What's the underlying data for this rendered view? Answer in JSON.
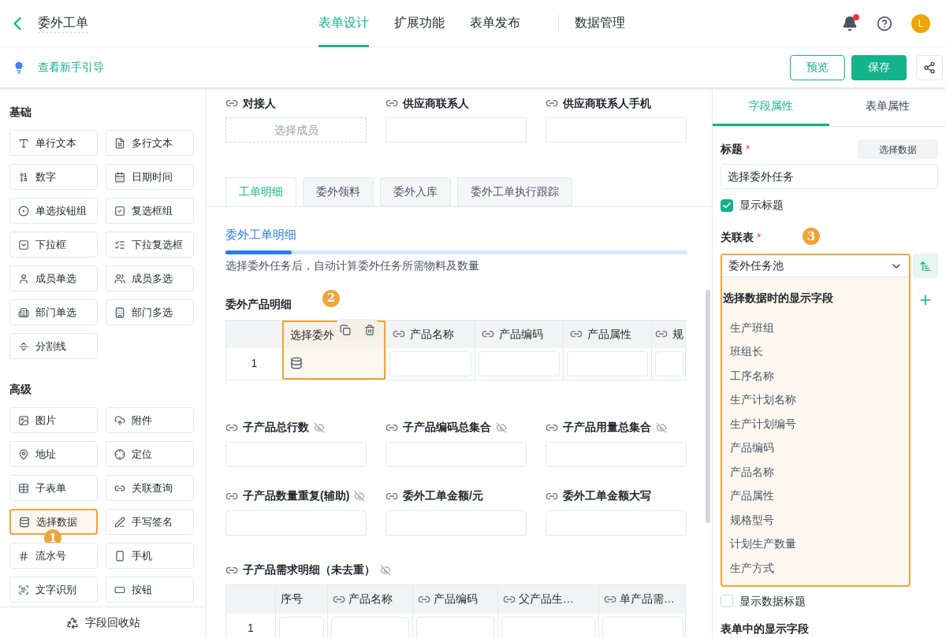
{
  "header": {
    "title": "委外工单",
    "tabs": [
      {
        "label": "表单设计",
        "selected": true
      },
      {
        "label": "扩展功能",
        "selected": false
      },
      {
        "label": "表单发布",
        "selected": false
      },
      {
        "label": "数据管理",
        "selected": false
      }
    ],
    "notification_dot": true,
    "avatar": "L"
  },
  "toolbar": {
    "guide_link": "查看新手引导",
    "preview": "预览",
    "save": "保存"
  },
  "palette": {
    "sections": [
      {
        "title": "基础",
        "items": [
          {
            "label": "单行文本",
            "highlighted": false
          },
          {
            "label": "多行文本",
            "highlighted": false
          },
          {
            "label": "数字",
            "highlighted": false
          },
          {
            "label": "日期时间",
            "highlighted": false
          },
          {
            "label": "单选按钮组",
            "highlighted": false
          },
          {
            "label": "复选框组",
            "highlighted": false
          },
          {
            "label": "下拉框",
            "highlighted": false
          },
          {
            "label": "下拉复选框",
            "highlighted": false
          },
          {
            "label": "成员单选",
            "highlighted": false
          },
          {
            "label": "成员多选",
            "highlighted": false
          },
          {
            "label": "部门单选",
            "highlighted": false
          },
          {
            "label": "部门多选",
            "highlighted": false
          },
          {
            "label": "分割线",
            "highlighted": false
          }
        ]
      },
      {
        "title": "高级",
        "items": [
          {
            "label": "图片",
            "highlighted": false
          },
          {
            "label": "附件",
            "highlighted": false
          },
          {
            "label": "地址",
            "highlighted": false
          },
          {
            "label": "定位",
            "highlighted": false
          },
          {
            "label": "子表单",
            "highlighted": false
          },
          {
            "label": "关联查询",
            "highlighted": false
          },
          {
            "label": "选择数据",
            "highlighted": true,
            "badge": "1"
          },
          {
            "label": "手写签名",
            "highlighted": false
          },
          {
            "label": "流水号",
            "highlighted": false
          },
          {
            "label": "手机",
            "highlighted": false
          },
          {
            "label": "文字识别",
            "highlighted": false
          },
          {
            "label": "按钮",
            "highlighted": false
          }
        ]
      }
    ],
    "recycle_bin": "字段回收站"
  },
  "canvas": {
    "top_fields": [
      {
        "label": "对接人",
        "kind": "member",
        "placeholder": "选择成员",
        "hidden": false
      },
      {
        "label": "供应商联系人",
        "kind": "text",
        "hidden": false
      },
      {
        "label": "供应商联系人手机",
        "kind": "text",
        "hidden": false
      }
    ],
    "tabs": [
      {
        "label": "工单明细",
        "selected": true
      },
      {
        "label": "委外领料",
        "selected": false
      },
      {
        "label": "委外入库",
        "selected": false
      },
      {
        "label": "委外工单执行跟踪",
        "selected": false
      }
    ],
    "section_title": "委外工单明细",
    "section_description": "选择委外任务后，自动计算委外任务所需物料及数量",
    "subtable": {
      "title": "委外产品明细",
      "badge": "2",
      "columns": [
        {
          "label": "选择委外",
          "kind": "select_data",
          "highlighted": true
        },
        {
          "label": "产品名称",
          "kind": "linked"
        },
        {
          "label": "产品编码",
          "kind": "linked"
        },
        {
          "label": "产品属性",
          "kind": "linked"
        },
        {
          "label": "规",
          "kind": "linked"
        }
      ],
      "row_number": "1"
    },
    "fields": [
      {
        "label": "子产品总行数",
        "kind": "text",
        "hidden": true
      },
      {
        "label": "子产品编码总集合",
        "kind": "text",
        "hidden": true
      },
      {
        "label": "子产品用量总集合",
        "kind": "text",
        "hidden": true
      },
      {
        "label": "子产品数量重复(辅助)",
        "kind": "text",
        "hidden": true
      },
      {
        "label": "委外工单金额/元",
        "kind": "text",
        "hidden": false
      },
      {
        "label": "委外工单金额大写",
        "kind": "text",
        "hidden": false
      }
    ],
    "subtable2": {
      "title": "子产品需求明细（未去重）",
      "hidden": true,
      "columns": [
        {
          "label": "序号",
          "kind": "plain"
        },
        {
          "label": "产品名称",
          "kind": "linked"
        },
        {
          "label": "产品编码",
          "kind": "linked"
        },
        {
          "label": "父产品生…",
          "kind": "linked"
        },
        {
          "label": "单产品需…",
          "kind": "linked"
        }
      ],
      "row_number": "1"
    }
  },
  "properties": {
    "tabs": [
      {
        "label": "字段属性",
        "selected": true
      },
      {
        "label": "表单属性",
        "selected": false
      }
    ],
    "title_label": "标题",
    "title_required": "*",
    "linked_table_required": "*",
    "select_data_button": "选择数据",
    "title_value": "选择委外任务",
    "show_title": {
      "label": "显示标题",
      "checked": true
    },
    "linked_table_label": "关联表",
    "badge": "3",
    "linked_table_value": "委外任务池",
    "display_fields_heading": "选择数据时的显示字段",
    "display_fields": [
      "生产班组",
      "班组长",
      "工序名称",
      "生产计划名称",
      "生产计划编号",
      "产品编码",
      "产品名称",
      "产品属性",
      "规格型号",
      "计划生产数量",
      "生产方式"
    ],
    "show_data_title": {
      "label": "显示数据标题",
      "checked": false
    },
    "form_display_heading": "表单中的显示字段"
  }
}
